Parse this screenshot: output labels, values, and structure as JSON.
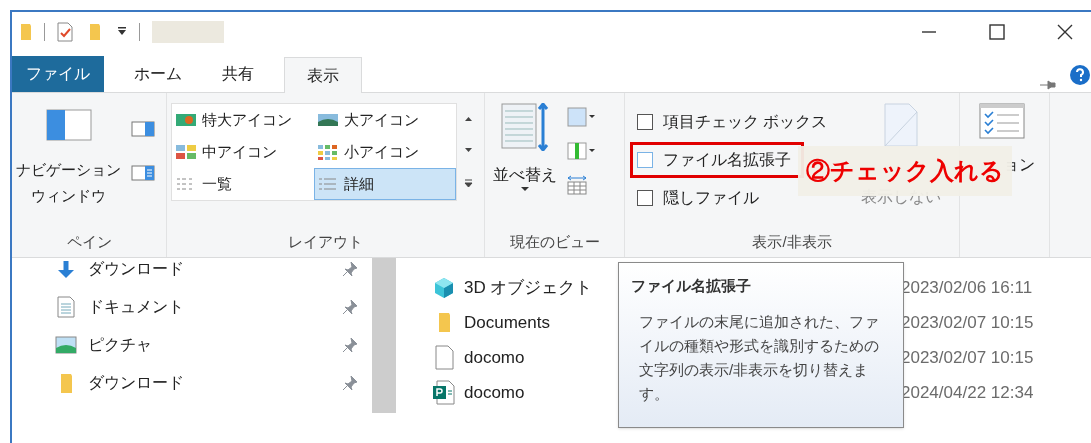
{
  "tabs": [
    {
      "label": "ファイル",
      "kind": "file",
      "selected": false
    },
    {
      "label": "ホーム",
      "kind": "tab",
      "selected": false
    },
    {
      "label": "共有",
      "kind": "tab",
      "selected": false
    },
    {
      "label": "表示",
      "kind": "tab",
      "selected": true
    }
  ],
  "ribbon": {
    "pane": {
      "nav_button": [
        "ナビゲーション",
        "ウィンドウ"
      ],
      "label": "ペイン"
    },
    "layout": {
      "items": [
        {
          "label": "特大アイコン",
          "selected": false
        },
        {
          "label": "大アイコン",
          "selected": false
        },
        {
          "label": "中アイコン",
          "selected": false
        },
        {
          "label": "小アイコン",
          "selected": false
        },
        {
          "label": "一覧",
          "selected": false
        },
        {
          "label": "詳細",
          "selected": true
        }
      ],
      "label": "レイアウト"
    },
    "current_view": {
      "sort_button": "並べ替え",
      "label": "現在のビュー"
    },
    "show_hide": {
      "checkboxes": [
        {
          "label": "項目チェック ボックス",
          "checked": false,
          "highlighted": false
        },
        {
          "label": "ファイル名拡張子",
          "checked": false,
          "highlighted": true
        },
        {
          "label": "隠しファイル",
          "checked": false,
          "highlighted": false
        }
      ],
      "hide_selected": "表示しない",
      "label": "表示/非表示"
    },
    "options": {
      "label": "ョン"
    }
  },
  "annotation": "②チェック入れる",
  "nav_pane": {
    "items": [
      {
        "label": "ダウンロード",
        "kind": "download"
      },
      {
        "label": "ドキュメント",
        "kind": "document"
      },
      {
        "label": "ピクチャ",
        "kind": "pictures"
      },
      {
        "label": "ダウンロード",
        "kind": "folder"
      }
    ]
  },
  "files": [
    {
      "name": "3D オブジェクト",
      "kind": "cube",
      "modified": "2023/02/06 16:11"
    },
    {
      "name": "Documents",
      "kind": "folder",
      "modified": "2023/02/07 10:15"
    },
    {
      "name": "docomo",
      "kind": "file",
      "modified": "2023/02/07 10:15"
    },
    {
      "name": "docomo",
      "kind": "publisher",
      "modified": "2024/04/22 12:34"
    }
  ],
  "tooltip": {
    "title": "ファイル名拡張子",
    "body": "ファイルの末尾に追加された、ファイルの種類や形式を識別するための文字列の表示/非表示を切り替えます。"
  }
}
